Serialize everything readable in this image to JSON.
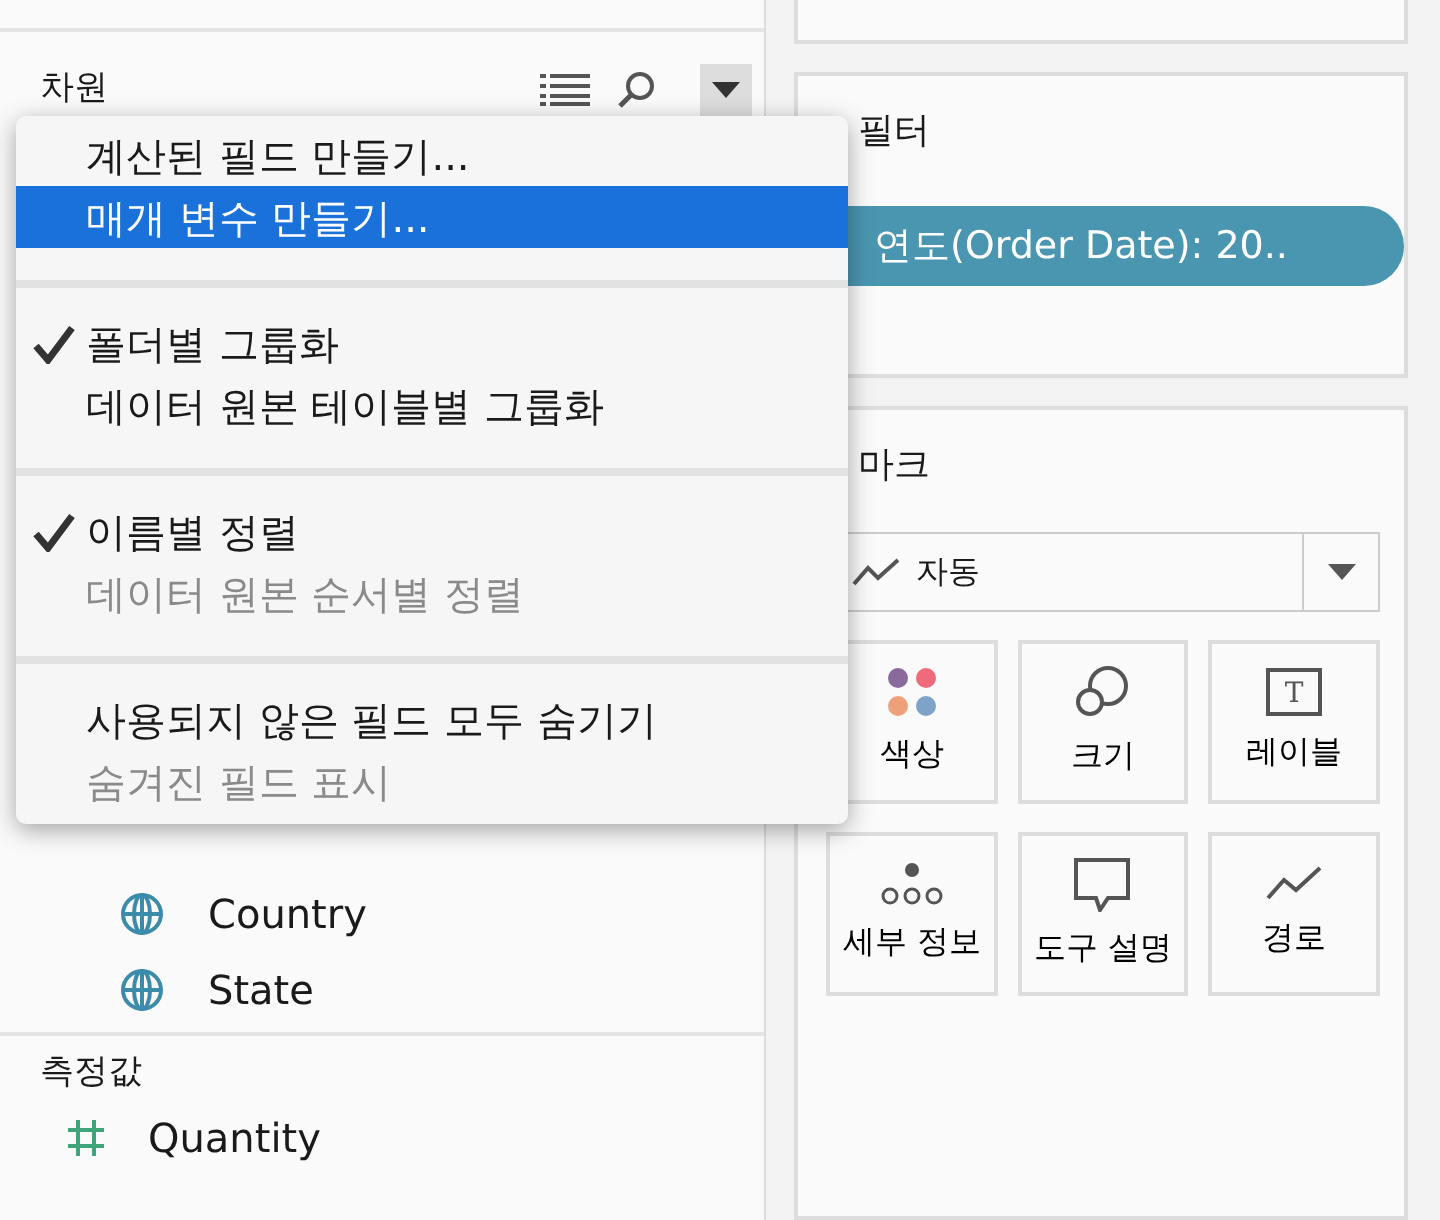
{
  "dimensions_panel": {
    "title": "차원",
    "fields": [
      {
        "name": "Country",
        "kind": "geo"
      },
      {
        "name": "State",
        "kind": "geo"
      }
    ]
  },
  "measures_panel": {
    "title": "측정값",
    "fields": [
      {
        "name": "Quantity",
        "kind": "measure"
      }
    ]
  },
  "context_menu": {
    "items": [
      {
        "kind": "item",
        "label": "계산된 필드 만들기...",
        "checked": false,
        "disabled": false,
        "selected": false
      },
      {
        "kind": "item",
        "label": "매개 변수 만들기...",
        "checked": false,
        "disabled": false,
        "selected": true
      },
      {
        "kind": "separator"
      },
      {
        "kind": "item",
        "label": "폴더별 그룹화",
        "checked": true,
        "disabled": false,
        "selected": false
      },
      {
        "kind": "item",
        "label": "데이터 원본 테이블별 그룹화",
        "checked": false,
        "disabled": false,
        "selected": false
      },
      {
        "kind": "separator"
      },
      {
        "kind": "item",
        "label": "이름별 정렬",
        "checked": true,
        "disabled": false,
        "selected": false
      },
      {
        "kind": "item",
        "label": "데이터 원본 순서별 정렬",
        "checked": false,
        "disabled": true,
        "selected": false
      },
      {
        "kind": "separator"
      },
      {
        "kind": "item",
        "label": "사용되지 않은 필드 모두 숨기기",
        "checked": false,
        "disabled": false,
        "selected": false
      },
      {
        "kind": "item",
        "label": "숨겨진 필드 표시",
        "checked": false,
        "disabled": true,
        "selected": false
      }
    ]
  },
  "filters_card": {
    "title": "필터",
    "pills": [
      {
        "label": "연도(Order Date): 20.."
      }
    ]
  },
  "marks_card": {
    "title": "마크",
    "mark_type": "자동",
    "buttons": [
      {
        "kind": "color",
        "label": "색상"
      },
      {
        "kind": "size",
        "label": "크기"
      },
      {
        "kind": "label",
        "label": "레이블",
        "icon_text": "T"
      },
      {
        "kind": "detail",
        "label": "세부 정보"
      },
      {
        "kind": "tooltip",
        "label": "도구 설명"
      },
      {
        "kind": "path",
        "label": "경로"
      }
    ]
  }
}
